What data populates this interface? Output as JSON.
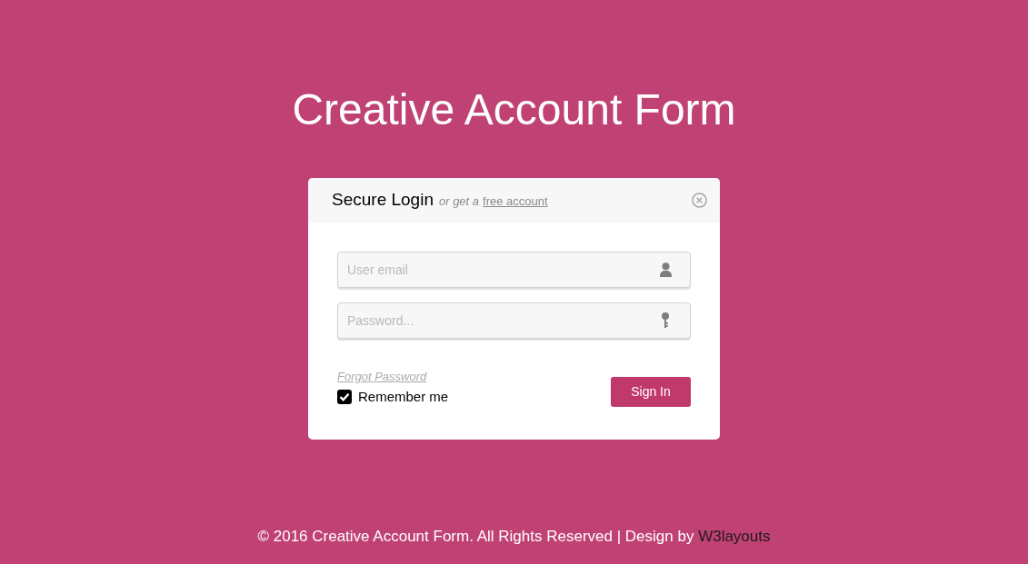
{
  "title": "Creative Account Form",
  "login_card": {
    "heading": "Secure Login",
    "subheading": "or get a",
    "signup_link": "free account",
    "fields": [
      {
        "kind": "email",
        "placeholder": "User email"
      },
      {
        "kind": "password",
        "placeholder": "Password..."
      }
    ],
    "forgot_link": "Forgot Password",
    "remember": {
      "label": "Remember me",
      "checked": true
    },
    "button": "Sign In"
  },
  "footer": {
    "text": "© 2016 Creative Account Form. All Rights Reserved | Design by",
    "link": "W3layouts"
  }
}
